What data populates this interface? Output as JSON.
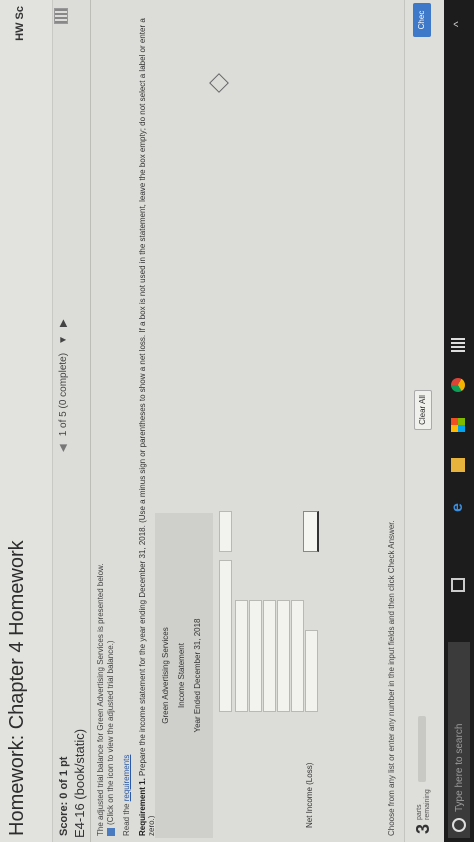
{
  "header": {
    "title": "Homework: Chapter 4 Homework",
    "hw_score_label": "HW Sc"
  },
  "question": {
    "score": "Score: 0 of 1 pt",
    "nav_text": "1 of 5 (0 complete)",
    "title": "E4-16 (book/static)"
  },
  "intro": {
    "line1": "The adjusted trial balance for Green Advertising Services is presented below.",
    "line2": "(Click on the icon to view the adjusted trial balance.)",
    "read_prefix": "Read the",
    "read_link": "requirements"
  },
  "requirement": {
    "label": "Requirement 1.",
    "text": "Prepare the income statement for the year ending December 31, 2018. (Use a minus sign or parentheses to show a net loss. If a box is not used in the statement, leave the box empty; do not select a label or enter a zero.)"
  },
  "statement": {
    "company": "Green Advertising Services",
    "title": "Income Statement",
    "period": "Year Ended December 31, 2018",
    "net_income_label": "Net Income (Loss)"
  },
  "instructions": "Choose from any list or enter any number in the input fields and then click Check Answer.",
  "footer": {
    "parts_num": "3",
    "parts_label": "parts",
    "parts_remaining": "remaining",
    "progress_value": 0.0,
    "clear_all": "Clear All",
    "check_answer": "Chec"
  },
  "taskbar": {
    "search_placeholder": "Type here to search"
  },
  "colors": {
    "accent": "#3e78c8",
    "background": "#dcdcd8",
    "taskbar": "#1c1c1c"
  }
}
